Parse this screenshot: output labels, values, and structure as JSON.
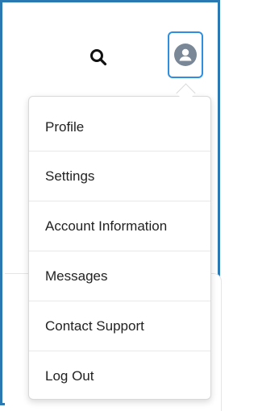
{
  "header": {
    "search_icon": "search-icon",
    "avatar_icon": "user-avatar-icon",
    "accent_color": "#2e8fe0",
    "frame_color": "#2a79b3"
  },
  "menu": {
    "items": [
      {
        "label": "Profile"
      },
      {
        "label": "Settings"
      },
      {
        "label": "Account Information"
      },
      {
        "label": "Messages"
      },
      {
        "label": "Contact Support"
      },
      {
        "label": "Log Out"
      }
    ]
  }
}
